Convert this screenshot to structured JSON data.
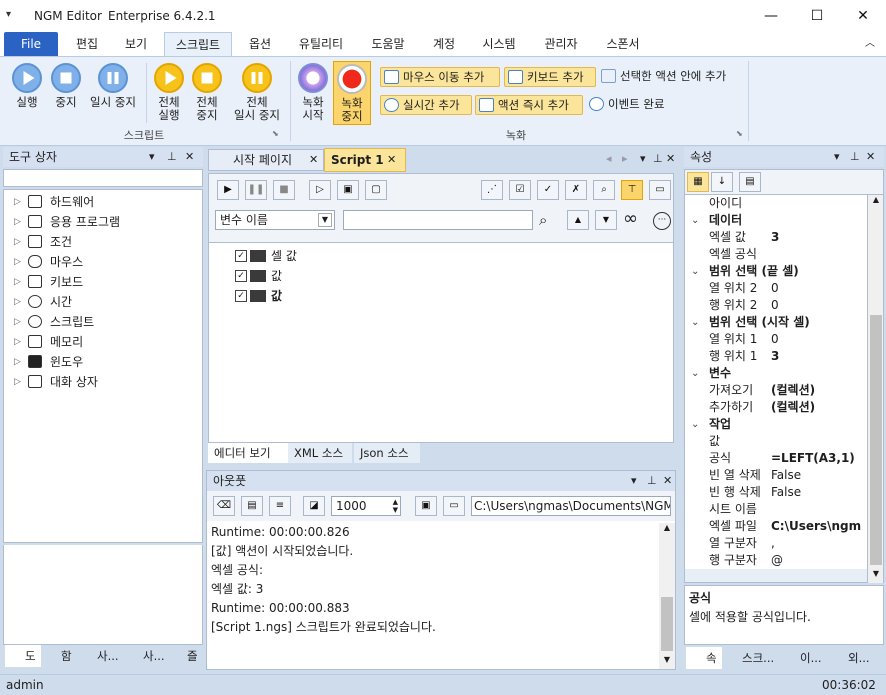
{
  "window": {
    "app_name": "NGM Editor",
    "edition": "Enterprise 6.4.2.1",
    "sys_menu_glyph": "▾",
    "min_glyph": "—",
    "max_glyph": "☐",
    "close_glyph": "✕"
  },
  "menu": {
    "file": "File",
    "items": [
      "편집",
      "보기",
      "스크립트",
      "옵션",
      "유틸리티",
      "도움말",
      "계정",
      "시스템",
      "관리자",
      "스폰서"
    ],
    "collapse_glyph": "︿"
  },
  "ribbon": {
    "script_group": {
      "label": "스크립트",
      "run": "실행",
      "stop": "중지",
      "pause": "일시 중지",
      "run_all_1": "전체",
      "run_all_2": "실행",
      "stop_all_1": "전체",
      "stop_all_2": "중지",
      "pause_all_1": "전체",
      "pause_all_2": "일시 중지"
    },
    "record_group": {
      "label": "녹화",
      "start_1": "녹화",
      "start_2": "시작",
      "stop_1": "녹화",
      "stop_2": "중지",
      "mouse_move": "마우스 이동 추가",
      "keyboard": "키보드 추가",
      "inside_action": "선택한 액션 안에 추가",
      "realtime": "실시간 추가",
      "action_now": "액션 즉시 추가",
      "event_done": "이벤트 완료"
    }
  },
  "toolbox": {
    "title": "도구 상자",
    "items": [
      "하드웨어",
      "응용 프로그램",
      "조건",
      "마우스",
      "키보드",
      "시간",
      "스크립트",
      "메모리",
      "윈도우",
      "대화 상자"
    ],
    "bottom_tabs": [
      "도",
      "함",
      "사...",
      "사...",
      "즐"
    ]
  },
  "editor": {
    "tabs": [
      "시작 페이지",
      "Script 1"
    ],
    "var_select": "변수 이름",
    "tree": [
      "셀 값",
      "값",
      "값"
    ],
    "view_tabs": [
      "에디터 보기",
      "XML 소스",
      "Json 소스"
    ]
  },
  "output": {
    "title": "아웃풋",
    "count": "1000",
    "path": "C:\\Users\\ngmas\\Documents\\NGM6\\",
    "lines": [
      "Runtime: 00:00:00.826",
      "[값] 액션이 시작되었습니다.",
      "엑셀 공식:",
      "엑셀 값: 3",
      "Runtime: 00:00:00.883",
      "[Script 1.ngs] 스크립트가 완료되었습니다."
    ]
  },
  "properties": {
    "title": "속성",
    "rows": [
      {
        "type": "prop",
        "k": "아이디",
        "v": ""
      },
      {
        "type": "cat",
        "k": "데이터"
      },
      {
        "type": "prop",
        "k": "엑셀 값",
        "v": "3",
        "bold": true
      },
      {
        "type": "prop",
        "k": "엑셀 공식",
        "v": ""
      },
      {
        "type": "cat",
        "k": "범위 선택 (끝 셀)"
      },
      {
        "type": "prop",
        "k": "열 위치 2",
        "v": "0"
      },
      {
        "type": "prop",
        "k": "행 위치 2",
        "v": "0"
      },
      {
        "type": "cat",
        "k": "범위 선택 (시작 셀)"
      },
      {
        "type": "prop",
        "k": "열 위치 1",
        "v": "0"
      },
      {
        "type": "prop",
        "k": "행 위치 1",
        "v": "3",
        "bold": true
      },
      {
        "type": "cat",
        "k": "변수"
      },
      {
        "type": "prop",
        "k": "가져오기",
        "v": "(컬렉션)",
        "bold": true
      },
      {
        "type": "prop",
        "k": "추가하기",
        "v": "(컬렉션)",
        "bold": true
      },
      {
        "type": "cat",
        "k": "작업"
      },
      {
        "type": "prop",
        "k": "값",
        "v": ""
      },
      {
        "type": "prop",
        "k": "공식",
        "v": "=LEFT(A3,1)",
        "bold": true
      },
      {
        "type": "prop",
        "k": "빈 열 삭제",
        "v": "False"
      },
      {
        "type": "prop",
        "k": "빈 행 삭제",
        "v": "False"
      },
      {
        "type": "prop",
        "k": "시트 이름",
        "v": ""
      },
      {
        "type": "prop",
        "k": "엑셀 파일",
        "v": "C:\\Users\\ngm",
        "bold": true
      },
      {
        "type": "prop",
        "k": "열 구분자",
        "v": ","
      },
      {
        "type": "prop",
        "k": "행 구분자",
        "v": "@"
      }
    ],
    "desc_title": "공식",
    "desc_text": "셀에 적용할 공식입니다.",
    "bottom_tabs": [
      "속",
      "스크...",
      "이...",
      "외..."
    ]
  },
  "status": {
    "user": "admin",
    "time": "00:36:02"
  },
  "colors": {
    "accent": "#2a63c4",
    "highlight": "#fbe59a",
    "panel_bg": "#cfdcec"
  }
}
